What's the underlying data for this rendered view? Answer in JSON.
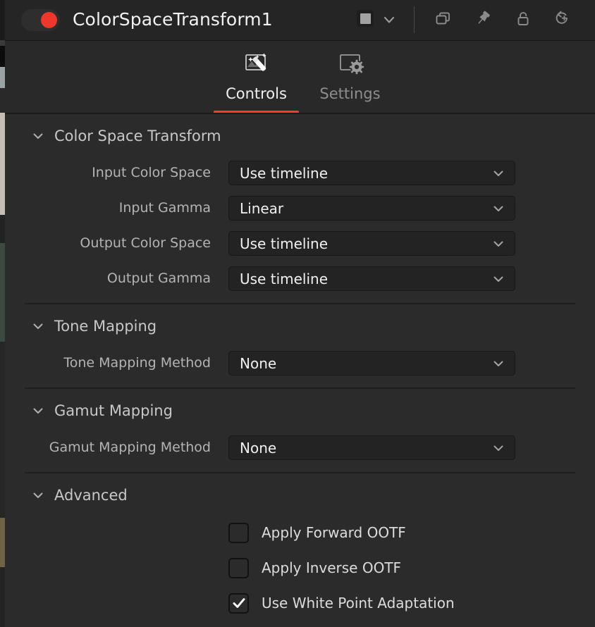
{
  "titlebar": {
    "toggle_name": "node-enable-toggle",
    "toggle_state": "on",
    "title": "ColorSpaceTransform1",
    "swatch_color": "#a2a2a2",
    "icons": [
      {
        "name": "duplicate-icon",
        "label": "Duplicate"
      },
      {
        "name": "pin-icon",
        "label": "Pin"
      },
      {
        "name": "lock-icon",
        "label": "Lock"
      },
      {
        "name": "reset-icon",
        "label": "Reset"
      }
    ]
  },
  "tabs": [
    {
      "label": "Controls",
      "icon": "magic-wand-icon",
      "active": true
    },
    {
      "label": "Settings",
      "icon": "gear-icon",
      "active": false
    }
  ],
  "accent_color": "#fb3b30",
  "sections": [
    {
      "id": "color-space-transform",
      "title": "Color Space Transform",
      "expanded": true,
      "rows": [
        {
          "label": "Input Color Space",
          "value": "Use timeline",
          "type": "dropdown"
        },
        {
          "label": "Input Gamma",
          "value": "Linear",
          "type": "dropdown"
        },
        {
          "label": "Output Color Space",
          "value": "Use timeline",
          "type": "dropdown"
        },
        {
          "label": "Output Gamma",
          "value": "Use timeline",
          "type": "dropdown"
        }
      ]
    },
    {
      "id": "tone-mapping",
      "title": "Tone Mapping",
      "expanded": true,
      "rows": [
        {
          "label": "Tone Mapping Method",
          "value": "None",
          "type": "dropdown"
        }
      ]
    },
    {
      "id": "gamut-mapping",
      "title": "Gamut Mapping",
      "expanded": true,
      "rows": [
        {
          "label": "Gamut Mapping Method",
          "value": "None",
          "type": "dropdown"
        }
      ]
    },
    {
      "id": "advanced",
      "title": "Advanced",
      "expanded": true,
      "rows": [
        {
          "label": "Apply Forward OOTF",
          "checked": false,
          "type": "checkbox"
        },
        {
          "label": "Apply Inverse OOTF",
          "checked": false,
          "type": "checkbox"
        },
        {
          "label": "Use White Point Adaptation",
          "checked": true,
          "type": "checkbox"
        }
      ]
    }
  ]
}
